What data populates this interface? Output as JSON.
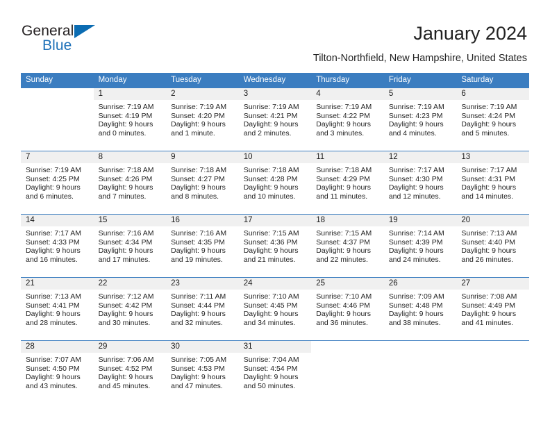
{
  "brand": {
    "general": "General",
    "blue": "Blue",
    "triangle_color": "#0b6cb2"
  },
  "header": {
    "title": "January 2024",
    "location": "Tilton-Northfield, New Hampshire, United States"
  },
  "theme": {
    "header_blue": "#3b7dc0",
    "daynum_band": "#f0f0f0",
    "text": "#222222"
  },
  "weekday_headers": [
    "Sunday",
    "Monday",
    "Tuesday",
    "Wednesday",
    "Thursday",
    "Friday",
    "Saturday"
  ],
  "weeks": [
    [
      {
        "day": "",
        "sunrise": "",
        "sunset": "",
        "daylight_1": "",
        "daylight_2": ""
      },
      {
        "day": "1",
        "sunrise": "Sunrise: 7:19 AM",
        "sunset": "Sunset: 4:19 PM",
        "daylight_1": "Daylight: 9 hours",
        "daylight_2": "and 0 minutes."
      },
      {
        "day": "2",
        "sunrise": "Sunrise: 7:19 AM",
        "sunset": "Sunset: 4:20 PM",
        "daylight_1": "Daylight: 9 hours",
        "daylight_2": "and 1 minute."
      },
      {
        "day": "3",
        "sunrise": "Sunrise: 7:19 AM",
        "sunset": "Sunset: 4:21 PM",
        "daylight_1": "Daylight: 9 hours",
        "daylight_2": "and 2 minutes."
      },
      {
        "day": "4",
        "sunrise": "Sunrise: 7:19 AM",
        "sunset": "Sunset: 4:22 PM",
        "daylight_1": "Daylight: 9 hours",
        "daylight_2": "and 3 minutes."
      },
      {
        "day": "5",
        "sunrise": "Sunrise: 7:19 AM",
        "sunset": "Sunset: 4:23 PM",
        "daylight_1": "Daylight: 9 hours",
        "daylight_2": "and 4 minutes."
      },
      {
        "day": "6",
        "sunrise": "Sunrise: 7:19 AM",
        "sunset": "Sunset: 4:24 PM",
        "daylight_1": "Daylight: 9 hours",
        "daylight_2": "and 5 minutes."
      }
    ],
    [
      {
        "day": "7",
        "sunrise": "Sunrise: 7:19 AM",
        "sunset": "Sunset: 4:25 PM",
        "daylight_1": "Daylight: 9 hours",
        "daylight_2": "and 6 minutes."
      },
      {
        "day": "8",
        "sunrise": "Sunrise: 7:18 AM",
        "sunset": "Sunset: 4:26 PM",
        "daylight_1": "Daylight: 9 hours",
        "daylight_2": "and 7 minutes."
      },
      {
        "day": "9",
        "sunrise": "Sunrise: 7:18 AM",
        "sunset": "Sunset: 4:27 PM",
        "daylight_1": "Daylight: 9 hours",
        "daylight_2": "and 8 minutes."
      },
      {
        "day": "10",
        "sunrise": "Sunrise: 7:18 AM",
        "sunset": "Sunset: 4:28 PM",
        "daylight_1": "Daylight: 9 hours",
        "daylight_2": "and 10 minutes."
      },
      {
        "day": "11",
        "sunrise": "Sunrise: 7:18 AM",
        "sunset": "Sunset: 4:29 PM",
        "daylight_1": "Daylight: 9 hours",
        "daylight_2": "and 11 minutes."
      },
      {
        "day": "12",
        "sunrise": "Sunrise: 7:17 AM",
        "sunset": "Sunset: 4:30 PM",
        "daylight_1": "Daylight: 9 hours",
        "daylight_2": "and 12 minutes."
      },
      {
        "day": "13",
        "sunrise": "Sunrise: 7:17 AM",
        "sunset": "Sunset: 4:31 PM",
        "daylight_1": "Daylight: 9 hours",
        "daylight_2": "and 14 minutes."
      }
    ],
    [
      {
        "day": "14",
        "sunrise": "Sunrise: 7:17 AM",
        "sunset": "Sunset: 4:33 PM",
        "daylight_1": "Daylight: 9 hours",
        "daylight_2": "and 16 minutes."
      },
      {
        "day": "15",
        "sunrise": "Sunrise: 7:16 AM",
        "sunset": "Sunset: 4:34 PM",
        "daylight_1": "Daylight: 9 hours",
        "daylight_2": "and 17 minutes."
      },
      {
        "day": "16",
        "sunrise": "Sunrise: 7:16 AM",
        "sunset": "Sunset: 4:35 PM",
        "daylight_1": "Daylight: 9 hours",
        "daylight_2": "and 19 minutes."
      },
      {
        "day": "17",
        "sunrise": "Sunrise: 7:15 AM",
        "sunset": "Sunset: 4:36 PM",
        "daylight_1": "Daylight: 9 hours",
        "daylight_2": "and 21 minutes."
      },
      {
        "day": "18",
        "sunrise": "Sunrise: 7:15 AM",
        "sunset": "Sunset: 4:37 PM",
        "daylight_1": "Daylight: 9 hours",
        "daylight_2": "and 22 minutes."
      },
      {
        "day": "19",
        "sunrise": "Sunrise: 7:14 AM",
        "sunset": "Sunset: 4:39 PM",
        "daylight_1": "Daylight: 9 hours",
        "daylight_2": "and 24 minutes."
      },
      {
        "day": "20",
        "sunrise": "Sunrise: 7:13 AM",
        "sunset": "Sunset: 4:40 PM",
        "daylight_1": "Daylight: 9 hours",
        "daylight_2": "and 26 minutes."
      }
    ],
    [
      {
        "day": "21",
        "sunrise": "Sunrise: 7:13 AM",
        "sunset": "Sunset: 4:41 PM",
        "daylight_1": "Daylight: 9 hours",
        "daylight_2": "and 28 minutes."
      },
      {
        "day": "22",
        "sunrise": "Sunrise: 7:12 AM",
        "sunset": "Sunset: 4:42 PM",
        "daylight_1": "Daylight: 9 hours",
        "daylight_2": "and 30 minutes."
      },
      {
        "day": "23",
        "sunrise": "Sunrise: 7:11 AM",
        "sunset": "Sunset: 4:44 PM",
        "daylight_1": "Daylight: 9 hours",
        "daylight_2": "and 32 minutes."
      },
      {
        "day": "24",
        "sunrise": "Sunrise: 7:10 AM",
        "sunset": "Sunset: 4:45 PM",
        "daylight_1": "Daylight: 9 hours",
        "daylight_2": "and 34 minutes."
      },
      {
        "day": "25",
        "sunrise": "Sunrise: 7:10 AM",
        "sunset": "Sunset: 4:46 PM",
        "daylight_1": "Daylight: 9 hours",
        "daylight_2": "and 36 minutes."
      },
      {
        "day": "26",
        "sunrise": "Sunrise: 7:09 AM",
        "sunset": "Sunset: 4:48 PM",
        "daylight_1": "Daylight: 9 hours",
        "daylight_2": "and 38 minutes."
      },
      {
        "day": "27",
        "sunrise": "Sunrise: 7:08 AM",
        "sunset": "Sunset: 4:49 PM",
        "daylight_1": "Daylight: 9 hours",
        "daylight_2": "and 41 minutes."
      }
    ],
    [
      {
        "day": "28",
        "sunrise": "Sunrise: 7:07 AM",
        "sunset": "Sunset: 4:50 PM",
        "daylight_1": "Daylight: 9 hours",
        "daylight_2": "and 43 minutes."
      },
      {
        "day": "29",
        "sunrise": "Sunrise: 7:06 AM",
        "sunset": "Sunset: 4:52 PM",
        "daylight_1": "Daylight: 9 hours",
        "daylight_2": "and 45 minutes."
      },
      {
        "day": "30",
        "sunrise": "Sunrise: 7:05 AM",
        "sunset": "Sunset: 4:53 PM",
        "daylight_1": "Daylight: 9 hours",
        "daylight_2": "and 47 minutes."
      },
      {
        "day": "31",
        "sunrise": "Sunrise: 7:04 AM",
        "sunset": "Sunset: 4:54 PM",
        "daylight_1": "Daylight: 9 hours",
        "daylight_2": "and 50 minutes."
      },
      {
        "day": "",
        "sunrise": "",
        "sunset": "",
        "daylight_1": "",
        "daylight_2": ""
      },
      {
        "day": "",
        "sunrise": "",
        "sunset": "",
        "daylight_1": "",
        "daylight_2": ""
      },
      {
        "day": "",
        "sunrise": "",
        "sunset": "",
        "daylight_1": "",
        "daylight_2": ""
      }
    ]
  ]
}
